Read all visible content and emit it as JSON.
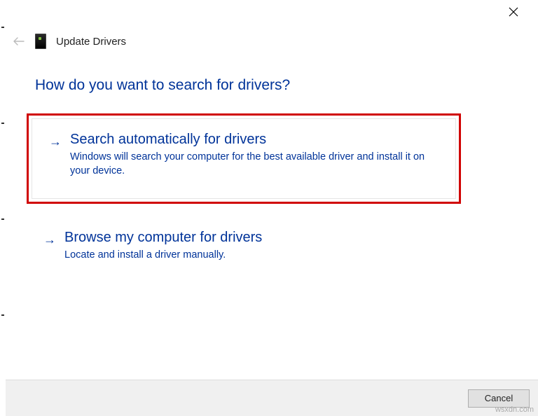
{
  "window": {
    "title": "Update Drivers"
  },
  "question": "How do you want to search for drivers?",
  "options": [
    {
      "title": "Search automatically for drivers",
      "description": "Windows will search your computer for the best available driver and install it on your device."
    },
    {
      "title": "Browse my computer for drivers",
      "description": "Locate and install a driver manually."
    }
  ],
  "footer": {
    "cancel": "Cancel"
  },
  "watermark": "wsxdn.com"
}
